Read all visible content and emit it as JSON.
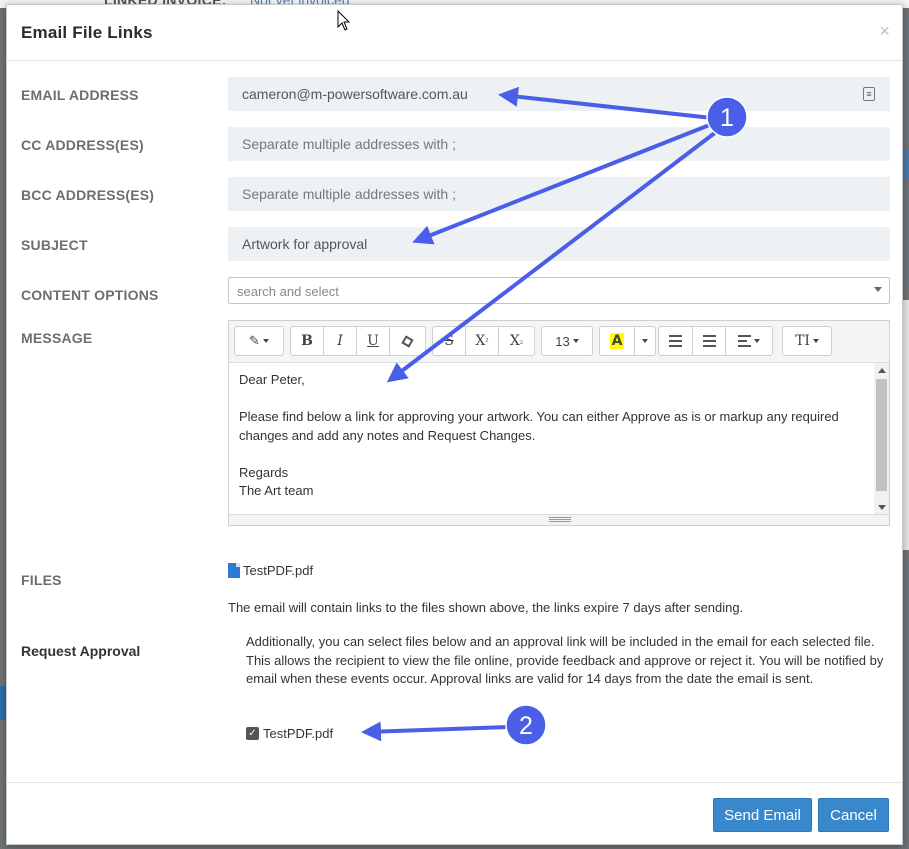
{
  "background": {
    "field_label": "LINKED INVOICE:",
    "field_value": "Not yet invoiced"
  },
  "modal": {
    "title": "Email File Links",
    "close_label": "×"
  },
  "form": {
    "email": {
      "label": "EMAIL ADDRESS",
      "value": "cameron@m-powersoftware.com.au",
      "icon": "contact-card-icon"
    },
    "cc": {
      "label": "CC ADDRESS(ES)",
      "placeholder": "Separate multiple addresses with ;"
    },
    "bcc": {
      "label": "BCC ADDRESS(ES)",
      "placeholder": "Separate multiple addresses with ;"
    },
    "subject": {
      "label": "SUBJECT",
      "value": "Artwork for approval"
    },
    "content_options": {
      "label": "CONTENT OPTIONS",
      "placeholder": "search and select"
    },
    "message": {
      "label": "MESSAGE",
      "toolbar": {
        "font_size": "13",
        "bold": "B",
        "italic": "I",
        "underline": "U",
        "strike": "S",
        "superscript": "X",
        "subscript": "X",
        "color_letter": "A",
        "text_style": "TI"
      },
      "body": {
        "greeting": "Dear Peter,",
        "paragraph": "Please find below a link for approving your artwork. You can either Approve as is or markup any required changes and add any notes and Request Changes.",
        "closing": "Regards",
        "signature": "The Art team"
      }
    }
  },
  "files": {
    "label": "FILES",
    "file_name": "TestPDF.pdf",
    "note": "The email will contain links to the files shown above, the links expire 7 days after sending."
  },
  "approval": {
    "label": "Request Approval",
    "description": "Additionally, you can select files below and an approval link will be included in the email for each selected file. This allows the recipient to view the file online, provide feedback and approve or reject it. You will be notified by email when these events occur. Approval links are valid for 14 days from the date the email is sent.",
    "file_name": "TestPDF.pdf",
    "checked": true
  },
  "footer": {
    "send_label": "Send Email",
    "cancel_label": "Cancel"
  },
  "annotations": {
    "marker_1": "1",
    "marker_2": "2",
    "color": "#4a5ee8"
  }
}
